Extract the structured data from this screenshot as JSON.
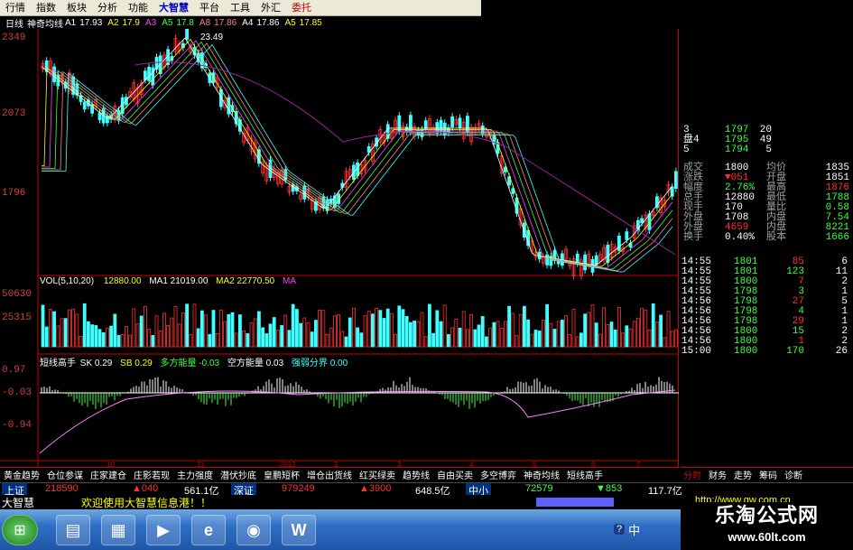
{
  "menu": {
    "items": [
      "行情",
      "指数",
      "板块",
      "分析",
      "功能",
      "大智慧",
      "平台",
      "工具",
      "外汇",
      "委托"
    ]
  },
  "chart_header": {
    "period": "日线",
    "indicator": "神奇均线",
    "a1_label": "A1",
    "a1_val": "17.93",
    "a2_label": "A2",
    "a2_val": "17.9",
    "a3_label": "A3",
    "a5_label": "A5",
    "a5_val": "17.8",
    "a8_label": "A8",
    "a8_val": "17.86",
    "a4_label": "A4",
    "a4_val": "17.86",
    "a5b_label": "A5",
    "a5b_val": "17.85"
  },
  "price_axis": {
    "high": "2349",
    "mid": "2073",
    "low": "1796",
    "peak_label": "23.49"
  },
  "vol_header": {
    "label": "VOL(5,10,20)",
    "vol": "12880.00",
    "ma1_label": "MA1",
    "ma1": "21019.00",
    "ma2_label": "MA2",
    "ma2": "22770.50",
    "ma3_label": "MA"
  },
  "vol_axis": {
    "top": "50630",
    "mid": "25315"
  },
  "ind_header": {
    "name": "短线高手",
    "s1_label": "SK",
    "s1": "0.29",
    "s2_label": "SB",
    "s2": "0.29",
    "s3_label": "多方能量",
    "s3": "-0.03",
    "s4_label": "空方能量",
    "s4": "0.03",
    "s5_label": "强弱分界",
    "s5": "0.00"
  },
  "ind_axis": {
    "top": "0.97",
    "mid": "-0.03",
    "low": "-0.94"
  },
  "x_axis": {
    "label_10": "10",
    "label_11": "11",
    "year": "2012",
    "m2": "2",
    "m3": "3",
    "m4": "4",
    "m5": "5",
    "m6": "6",
    "m7": "7"
  },
  "order_book": [
    {
      "side": "3",
      "price": "1797",
      "vol": "20"
    },
    {
      "side": "盘4",
      "price": "1795",
      "vol": "49"
    },
    {
      "side": "5",
      "price": "1794",
      "vol": "5"
    }
  ],
  "quote": [
    {
      "l1": "成交",
      "v1": "1800",
      "l2": "均价",
      "v2": "1835"
    },
    {
      "l1": "涨跌",
      "v1": "▼051",
      "l2": "开盘",
      "v2": "1851"
    },
    {
      "l1": "幅度",
      "v1": "2.76%",
      "l2": "最高",
      "v2": "1876"
    },
    {
      "l1": "总手",
      "v1": "12880",
      "l2": "最低",
      "v2": "1788"
    },
    {
      "l1": "现手",
      "v1": "170",
      "l2": "量比",
      "v2": "0.58"
    },
    {
      "l1": "外盘",
      "v1": "1708",
      "l2": "内盘",
      "v2": "7.54"
    },
    {
      "l1": "外盘",
      "v1": "4659",
      "l2": "内盘",
      "v2": "8221"
    },
    {
      "l1": "换手",
      "v1": "0.40%",
      "l2": "股本",
      "v2": "1666"
    }
  ],
  "trades": [
    {
      "time": "14:55",
      "price": "1801",
      "vol": "85",
      "num": "6"
    },
    {
      "time": "14:55",
      "price": "1801",
      "vol": "123",
      "num": "11"
    },
    {
      "time": "14:55",
      "price": "1800",
      "vol": "7",
      "num": "2"
    },
    {
      "time": "14:55",
      "price": "1798",
      "vol": "3",
      "num": "1"
    },
    {
      "time": "14:56",
      "price": "1798",
      "vol": "27",
      "num": "5"
    },
    {
      "time": "14:56",
      "price": "1798",
      "vol": "4",
      "num": "1"
    },
    {
      "time": "14:56",
      "price": "1798",
      "vol": "29",
      "num": "1"
    },
    {
      "time": "14:56",
      "price": "1800",
      "vol": "15",
      "num": "2"
    },
    {
      "time": "14:56",
      "price": "1800",
      "vol": "1",
      "num": "2"
    },
    {
      "time": "15:00",
      "price": "1800",
      "vol": "170",
      "num": "26"
    }
  ],
  "indicator_tabs": [
    "黄金趋势",
    "仓位参谋",
    "庄家建仓",
    "庄影若现",
    "主力强度",
    "潜伏抄底",
    "皇鹏短杯",
    "增仓出货线",
    "红买绿卖",
    "趋势线",
    "自由买卖",
    "多空博弈",
    "神奇均线",
    "短线高手"
  ],
  "side_tabs": [
    "分时",
    "财务",
    "走势",
    "筹码",
    "诊断"
  ],
  "status": {
    "sh_label": "上证",
    "sh_val": "218590",
    "sh_chg": "▲040",
    "sh_amt": "561.1亿",
    "sz_label": "深证",
    "sz_val": "979249",
    "sz_chg": "▲3900",
    "sz_amt": "648.5亿",
    "zx_label": "中小",
    "zx_val": "72579",
    "zx_chg": "▼853",
    "zx_amt": "117.7亿"
  },
  "ticker": {
    "app": "大智慧",
    "msg": "欢迎使用大智慧信息港！！",
    "url": "http://www.gw.com.cn"
  },
  "taskbar": {
    "ime": "中"
  },
  "watermark": {
    "title": "乐淘公式网",
    "url": "www.60lt.com"
  },
  "colors": {
    "up": "#ff3030",
    "down": "#40ffff",
    "bg": "#000000",
    "grid": "#c00000"
  }
}
